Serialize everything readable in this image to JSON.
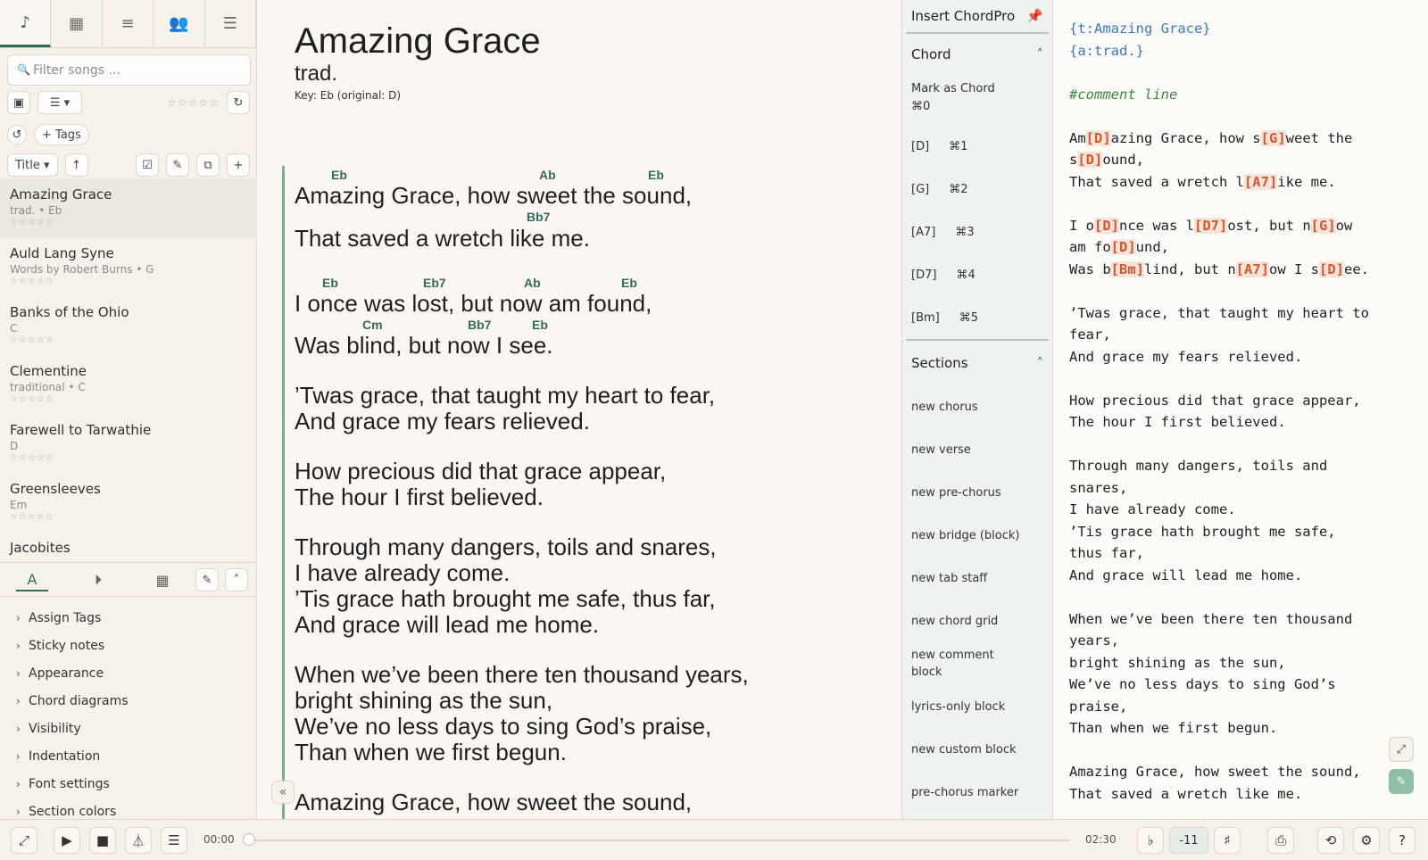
{
  "sidebar": {
    "tabs": [
      "songs",
      "keyboard",
      "setlists",
      "people",
      "settings"
    ],
    "filter_placeholder": "Filter songs ...",
    "tags_label": "+ Tags",
    "sort_label": "Title",
    "songs": [
      {
        "title": "Amazing Grace",
        "meta": "trad. • Eb"
      },
      {
        "title": "Auld Lang Syne",
        "meta": "Words by Robert Burns • G"
      },
      {
        "title": "Banks of the Ohio",
        "meta": "C"
      },
      {
        "title": "Clementine",
        "meta": "traditional • C"
      },
      {
        "title": "Farewell to Tarwathie",
        "meta": "D"
      },
      {
        "title": "Greensleeves",
        "meta": "Em"
      },
      {
        "title": "Jacobites",
        "meta": ""
      }
    ],
    "accordion": [
      "Assign Tags",
      "Sticky notes",
      "Appearance",
      "Chord diagrams",
      "Visibility",
      "Indentation",
      "Font settings",
      "Section colors"
    ]
  },
  "song": {
    "title": "Amazing Grace",
    "artist": "trad.",
    "key_text": "Key: Eb (original: D)",
    "chords": [
      "Eb",
      "Ab",
      "Eb",
      "Bb7",
      "Eb",
      "Eb7",
      "Ab",
      "Eb",
      "Cm",
      "Bb7",
      "Eb"
    ],
    "lines": [
      "Amazing Grace, how sweet the sound,",
      "That saved a wretch like me.",
      "I once was lost, but now am found,",
      "Was blind, but now I see.",
      "’Twas grace, that taught my heart to fear,",
      "And grace my fears relieved.",
      "How precious did that grace appear,",
      "The hour I first believed.",
      "Through many dangers, toils and snares,",
      "I have already come.",
      "’Tis grace hath brought me safe, thus far,",
      "And grace will lead me home.",
      "When we’ve been there ten thousand years,",
      "bright shining as the sun,",
      "We’ve no less days to sing God’s praise,",
      "Than when we first begun.",
      "Amazing Grace, how sweet the sound,"
    ]
  },
  "insert": {
    "title": "Insert ChordPro",
    "chord_section": "Chord",
    "mark_label": "Mark as Chord",
    "mark_shortcut": "⌘0",
    "chord_items": [
      {
        "chord": "[D]",
        "key": "⌘1"
      },
      {
        "chord": "[G]",
        "key": "⌘2"
      },
      {
        "chord": "[A7]",
        "key": "⌘3"
      },
      {
        "chord": "[D7]",
        "key": "⌘4"
      },
      {
        "chord": "[Bm]",
        "key": "⌘5"
      }
    ],
    "sections_title": "Sections",
    "section_items": [
      "new chorus",
      "new verse",
      "new pre-chorus",
      "new bridge (block)",
      "new tab staff",
      "new chord grid",
      "new comment block",
      "lyrics-only block",
      "new custom block",
      "pre-chorus marker"
    ]
  },
  "editor": {
    "directive_title": "{t:Amazing Grace}",
    "directive_artist": "{a:trad.}",
    "comment": "#comment line",
    "tokens": {
      "am": "Am",
      "d": "[D]",
      "g": "[G]",
      "a7": "[A7]",
      "d7": "[D7]",
      "bm": "[Bm]",
      "l1a": "azing Grace, how s",
      "l1b": "weet the",
      "l2a": "s",
      "l2b": "ound,",
      "l3a": "That saved a wretch l",
      "l3b": "ike me.",
      "l4a": "I o",
      "l4b": "nce was l",
      "l4c": "ost, but n",
      "l4d": "ow",
      "l5a": "am fo",
      "l5b": "und,",
      "l6a": "Was b",
      "l6b": "lind, but n",
      "l6c": "ow I s",
      "l6d": "ee."
    },
    "plain": [
      "’Twas grace, that taught my heart to",
      "fear,",
      "And grace my fears relieved.",
      "",
      "How precious did that grace appear,",
      "The hour I first believed.",
      "",
      "Through many dangers, toils and",
      "snares,",
      "I have already come.",
      "’Tis grace hath brought me safe,",
      "thus far,",
      "And grace will lead me home.",
      "",
      "When we’ve been there ten thousand",
      "years,",
      "bright shining as the sun,",
      "We’ve no less days to sing God’s",
      "praise,",
      "Than when we first begun.",
      "",
      "Amazing Grace, how sweet the sound,",
      "That saved a wretch like me."
    ]
  },
  "player": {
    "time_current": "00:00",
    "time_total": "02:30",
    "transpose_value": "-11",
    "flat": "♭",
    "sharp": "♯"
  }
}
